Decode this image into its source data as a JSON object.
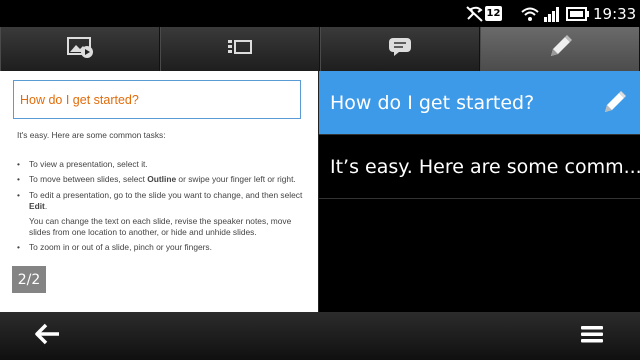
{
  "status_bar": {
    "sim_label": "12",
    "time": "19:33",
    "icons": [
      "mute-icon",
      "wifi-icon",
      "signal-icon",
      "battery-icon"
    ]
  },
  "toolbar": {
    "tabs": [
      {
        "icon": "slideshow-icon",
        "active": false
      },
      {
        "icon": "outline-icon",
        "active": false
      },
      {
        "icon": "notes-icon",
        "active": false
      },
      {
        "icon": "edit-icon",
        "active": true
      }
    ]
  },
  "slide": {
    "title": "How do I get started?",
    "intro": "It's easy. Here are some common tasks:",
    "bullet_1": "To view a presentation, select it.",
    "bullet_2_pre": "To move between slides, select ",
    "bullet_2_bold": "Outline",
    "bullet_2_post": " or swipe your finger left or right.",
    "bullet_3_pre": "To edit a presentation, go to the slide you want to change, and then select ",
    "bullet_3_bold": "Edit",
    "bullet_3_post": ".",
    "bullet_3_sub": "You can change the text on each slide, revise the speaker notes, move slides from one location to another, or hide and unhide slides.",
    "bullet_4": "To zoom in or out of a slide, pinch or  your fingers.",
    "page_indicator": "2/2"
  },
  "outline": {
    "items": [
      {
        "text": "How do I get started?",
        "selected": true
      },
      {
        "text": "It’s easy. Here are some comm...",
        "selected": false
      }
    ]
  },
  "colors": {
    "selected_row": "#3d9ae8",
    "slide_title": "#e36c0a",
    "title_box_border": "#5b9bd5"
  },
  "bottom_bar": {
    "icons": [
      "back-arrow-icon",
      "menu-icon"
    ]
  }
}
